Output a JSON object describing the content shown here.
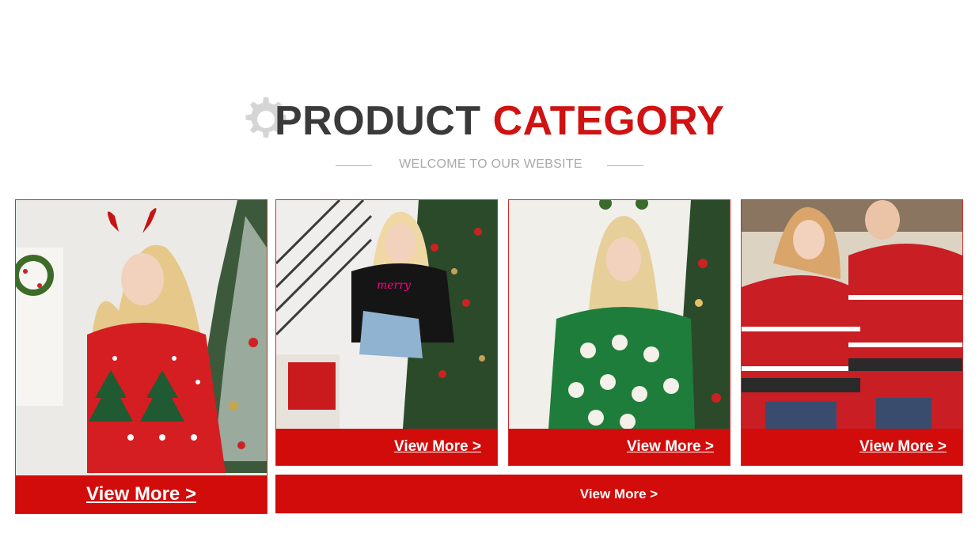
{
  "header": {
    "title_dark": "PRODUCT",
    "title_red": "CATEGORY",
    "subtitle": "WELCOME TO OUR WEBSITE"
  },
  "cards": [
    {
      "label": "View More >",
      "sweater": "red reindeer-antler sweater"
    },
    {
      "label": "View More >",
      "sweater": "black merry & bright sweater"
    },
    {
      "label": "View More >",
      "sweater": "green santa sweater"
    },
    {
      "label": "View More >",
      "sweater": "red fair-isle couple sweaters"
    }
  ],
  "wide_button": {
    "label": "View More >"
  },
  "colors": {
    "accent": "#d20b0b",
    "title_dark": "#3b3a3a",
    "subtitle": "#a9a9a9"
  }
}
